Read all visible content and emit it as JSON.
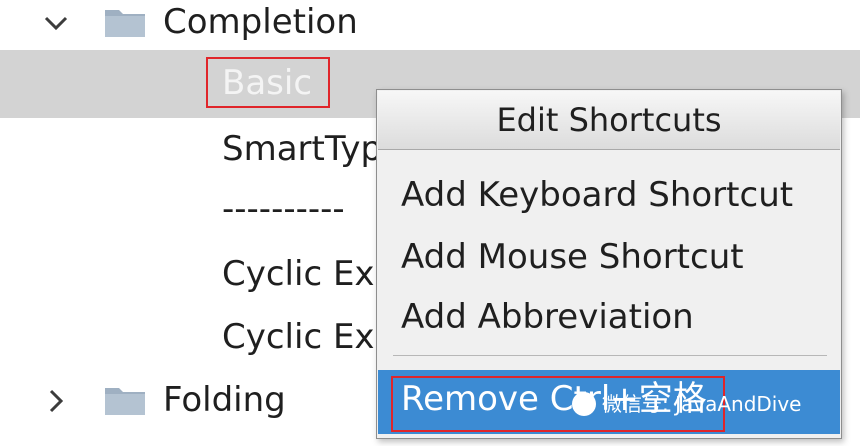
{
  "tree": {
    "completion_label": "Completion",
    "folding_label": "Folding",
    "children": [
      "SmartTyp",
      "----------",
      "Cyclic Exp",
      "Cyclic Exp"
    ],
    "selected": "Basic"
  },
  "menu": {
    "title": "Edit Shortcuts",
    "items": [
      "Add Keyboard Shortcut",
      "Add Mouse Shortcut",
      "Add Abbreviation"
    ],
    "remove": "Remove Ctrl+空格"
  },
  "watermark": "微信号: JavaAndDive",
  "colors": {
    "selection_bg": "#d3d3d3",
    "menu_highlight": "#3c8bd3",
    "red_outline": "#e0252a"
  }
}
